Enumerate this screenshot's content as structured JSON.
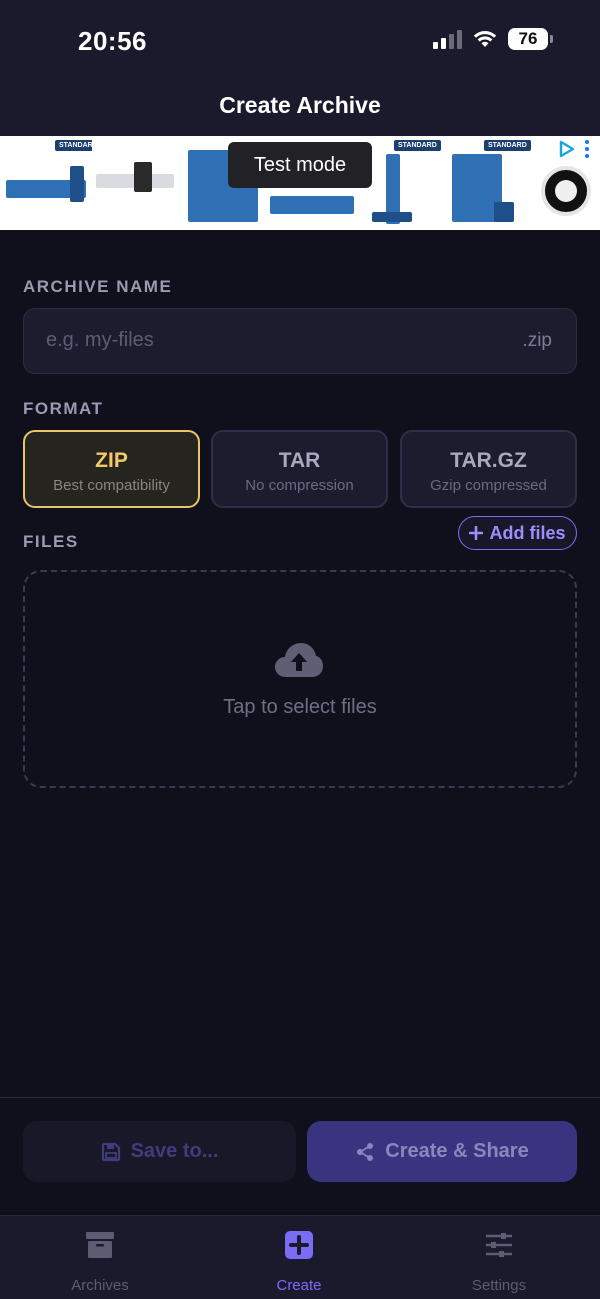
{
  "status_bar": {
    "time": "20:56",
    "battery": "76"
  },
  "header": {
    "title": "Create Archive"
  },
  "ad": {
    "badge_text": "Test mode",
    "tile_tag": "STANDARD"
  },
  "archive_name": {
    "label": "ARCHIVE NAME",
    "placeholder": "e.g. my-files",
    "value": "",
    "extension": ".zip"
  },
  "format": {
    "label": "FORMAT",
    "selected": "ZIP",
    "options": [
      {
        "title": "ZIP",
        "subtitle": "Best compatibility"
      },
      {
        "title": "TAR",
        "subtitle": "No compression"
      },
      {
        "title": "TAR.GZ",
        "subtitle": "Gzip compressed"
      }
    ]
  },
  "files": {
    "label": "FILES",
    "add_label": "Add files",
    "empty_text": "Tap to select files"
  },
  "actions": {
    "save_label": "Save to...",
    "create_label": "Create & Share"
  },
  "tabs": [
    {
      "label": "Archives",
      "icon": "archive-box-icon"
    },
    {
      "label": "Create",
      "icon": "plus-square-icon"
    },
    {
      "label": "Settings",
      "icon": "sliders-icon"
    }
  ],
  "colors": {
    "accent": "#7b6cf6",
    "selected_format": "#f2c86b",
    "background": "#10101c",
    "surface": "#1c1c2e"
  }
}
